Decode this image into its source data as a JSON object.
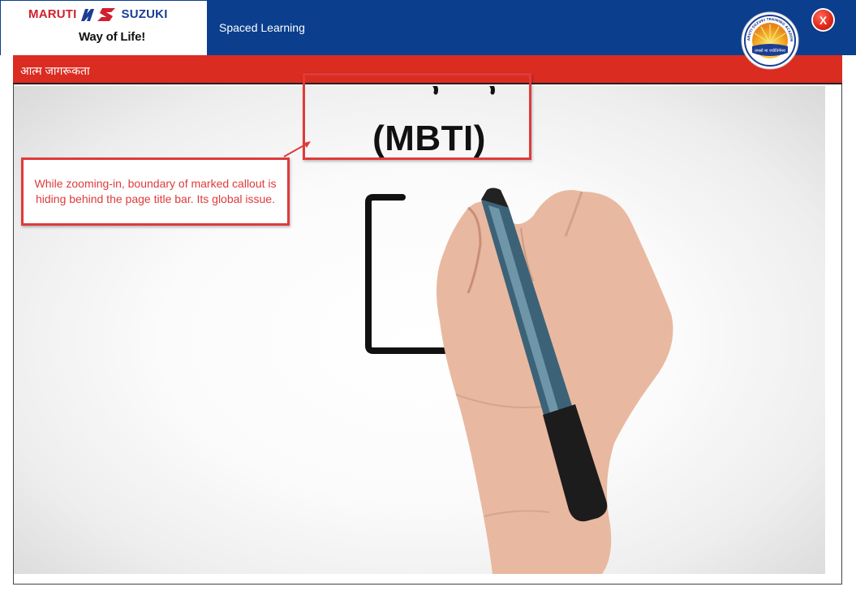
{
  "header": {
    "brand_left": "MARUTI",
    "brand_right": "SUZUKI",
    "tagline": "Way of Life!",
    "app_title": "Spaced Learning",
    "close_label": "X",
    "academy_logo_top_text": "MARUTI SUZUKI TRAINING ACADEMY",
    "academy_logo_bottom_text": "तमसो मा ज्योतिर्गमय"
  },
  "topic_bar": {
    "title": "आत्म जागरूकता"
  },
  "video": {
    "slide_text": "(MBTI)"
  },
  "annotation": {
    "callout_text": "While zooming-in, boundary of marked callout is hiding behind the page title bar. Its global issue.",
    "color": "#e03a3a"
  },
  "colors": {
    "header_blue": "#0b3f8e",
    "topic_red": "#da2c21",
    "brand_red": "#d0202f",
    "brand_blue": "#1b3d93"
  }
}
